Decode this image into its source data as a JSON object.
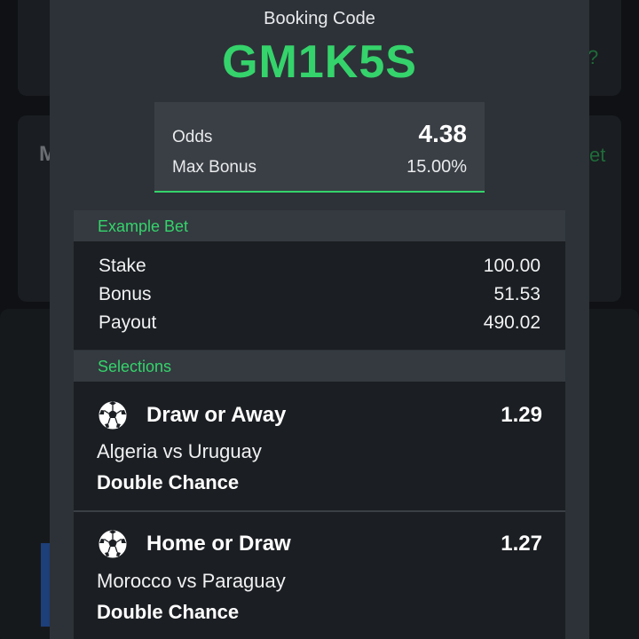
{
  "modal": {
    "booking_label": "Booking Code",
    "booking_code": "GM1K5S",
    "odds_label": "Odds",
    "odds_value": "4.38",
    "max_bonus_label": "Max Bonus",
    "max_bonus_value": "15.00%"
  },
  "example_bet": {
    "header": "Example Bet",
    "rows": [
      {
        "label": "Stake",
        "value": "100.00"
      },
      {
        "label": "Bonus",
        "value": "51.53"
      },
      {
        "label": "Payout",
        "value": "490.02"
      }
    ]
  },
  "selections": {
    "header": "Selections",
    "items": [
      {
        "pick": "Draw or Away",
        "odds": "1.29",
        "match": "Algeria vs Uruguay",
        "market": "Double Chance",
        "icon": "soccer-ball-icon"
      },
      {
        "pick": "Home or Draw",
        "odds": "1.27",
        "match": "Morocco vs Paraguay",
        "market": "Double Chance",
        "icon": "soccer-ball-icon"
      }
    ]
  },
  "colors": {
    "accent": "#35d36b",
    "modal_bg": "#2d3238",
    "card_bg": "#1b1e22"
  }
}
